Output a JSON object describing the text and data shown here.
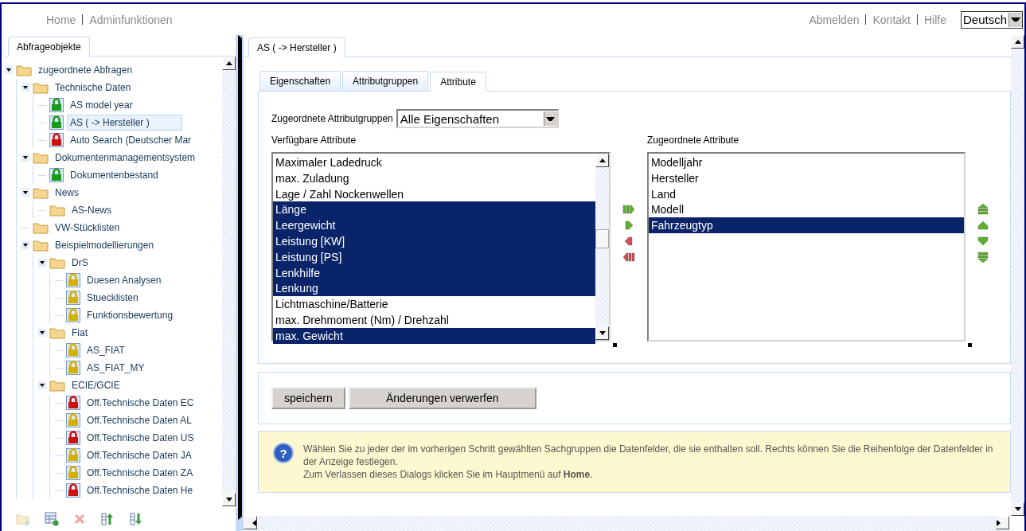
{
  "header": {
    "nav": [
      "Home",
      "Adminfunktionen"
    ],
    "links": [
      "Abmelden",
      "Kontakt",
      "Hilfe"
    ],
    "language": "Deutsch"
  },
  "sidebar": {
    "tab": {
      "label": "Abfrageobjekte",
      "selected": true
    },
    "tree": [
      {
        "kind": "folder",
        "label": "zugeordnete Abfragen",
        "expanded": true,
        "children": [
          {
            "kind": "folder",
            "label": "Technische Daten",
            "expanded": true,
            "children": [
              {
                "kind": "query",
                "label": "AS model year",
                "color": "#1a9a1a",
                "selected": false
              },
              {
                "kind": "query",
                "label": "AS ( -> Hersteller )",
                "color": "#1a9a1a",
                "selected": true
              },
              {
                "kind": "query",
                "label": "Auto Search (Deutscher Mar",
                "color": "#cc1111",
                "selected": false
              }
            ]
          },
          {
            "kind": "folder",
            "label": "Dokumentenmanagementsystem",
            "expanded": true,
            "children": [
              {
                "kind": "query",
                "label": "Dokumentenbestand",
                "color": "#1a9a1a",
                "selected": false
              }
            ]
          },
          {
            "kind": "folder",
            "label": "News",
            "expanded": true,
            "children": [
              {
                "kind": "folder",
                "label": "AS-News"
              }
            ]
          },
          {
            "kind": "folder",
            "label": "VW-Stücklisten"
          },
          {
            "kind": "folder",
            "label": "Beispielmodellierungen",
            "expanded": true,
            "children": [
              {
                "kind": "folder",
                "label": "DrS",
                "expanded": true,
                "children": [
                  {
                    "kind": "query",
                    "label": "Duesen Analysen",
                    "color": "#d4b000",
                    "selected": false
                  },
                  {
                    "kind": "query",
                    "label": "Stuecklisten",
                    "color": "#d4b000",
                    "selected": false
                  },
                  {
                    "kind": "query",
                    "label": "Funktionsbewertung",
                    "color": "#d4b000",
                    "selected": false
                  }
                ]
              },
              {
                "kind": "folder",
                "label": "Fiat",
                "expanded": true,
                "children": [
                  {
                    "kind": "query",
                    "label": "AS_FIAT",
                    "color": "#d4b000",
                    "selected": false
                  },
                  {
                    "kind": "query",
                    "label": "AS_FIAT_MY",
                    "color": "#d4b000",
                    "selected": false
                  }
                ]
              },
              {
                "kind": "folder",
                "label": "ECIE/GCIE",
                "expanded": true,
                "children": [
                  {
                    "kind": "query",
                    "label": "Off.Technische Daten EC",
                    "color": "#cc1111",
                    "selected": false
                  },
                  {
                    "kind": "query",
                    "label": "Off.Technische Daten AL",
                    "color": "#d4b000",
                    "selected": false
                  },
                  {
                    "kind": "query",
                    "label": "Off.Technische Daten US",
                    "color": "#cc1111",
                    "selected": false
                  },
                  {
                    "kind": "query",
                    "label": "Off.Technische Daten JA",
                    "color": "#d4b000",
                    "selected": false
                  },
                  {
                    "kind": "query",
                    "label": "Off.Technische Daten ZA",
                    "color": "#d4b000",
                    "selected": false
                  },
                  {
                    "kind": "query",
                    "label": "Off.Technische Daten He",
                    "color": "#cc1111",
                    "selected": false
                  }
                ]
              }
            ]
          }
        ]
      }
    ]
  },
  "main": {
    "tab": {
      "label": "AS ( -> Hersteller )",
      "selected": true
    },
    "subtabs": [
      {
        "label": "Eigenschaften",
        "selected": false
      },
      {
        "label": "Attributgruppen",
        "selected": false
      },
      {
        "label": "Attribute",
        "selected": true
      }
    ],
    "group_filter": {
      "label": "Zugeordnete Attributgruppen",
      "value": "Alle Eigenschaften"
    },
    "available": {
      "label": "Verfügbare Attribute",
      "items": [
        {
          "label": "Maximaler Ladedruck",
          "selected": false
        },
        {
          "label": "max. Zuladung",
          "selected": false
        },
        {
          "label": "Lage / Zahl Nockenwellen",
          "selected": false
        },
        {
          "label": "Länge",
          "selected": true
        },
        {
          "label": "Leergewicht",
          "selected": true
        },
        {
          "label": "Leistung [KW]",
          "selected": true
        },
        {
          "label": "Leistung [PS]",
          "selected": true
        },
        {
          "label": "Lenkhilfe",
          "selected": true
        },
        {
          "label": "Lenkung",
          "selected": true
        },
        {
          "label": "Lichtmaschine/Batterie",
          "selected": false
        },
        {
          "label": "max. Drehmoment (Nm) / Drehzahl",
          "selected": false
        },
        {
          "label": "max. Gewicht",
          "selected": true
        }
      ]
    },
    "assigned": {
      "label": "Zugeordnete Attribute",
      "items": [
        {
          "label": "Modelljahr",
          "selected": false
        },
        {
          "label": "Hersteller",
          "selected": false
        },
        {
          "label": "Land",
          "selected": false
        },
        {
          "label": "Modell",
          "selected": false
        },
        {
          "label": "Fahrzeugtyp",
          "selected": true
        }
      ]
    },
    "buttons": [
      "speichern",
      "Änderungen verwerfen"
    ],
    "info": {
      "icon": "?",
      "lines": [
        "Wählen Sie zu jeder der im vorherigen Schritt gewählten Sachgruppen die Datenfelder, die sie enthalten soll. Rechts können Sie die Reihenfolge der Datenfelder in der Anzeige festlegen.",
        "Zum Verlassen dieses Dialogs klicken Sie im Hauptmenü auf **Home**."
      ]
    }
  }
}
